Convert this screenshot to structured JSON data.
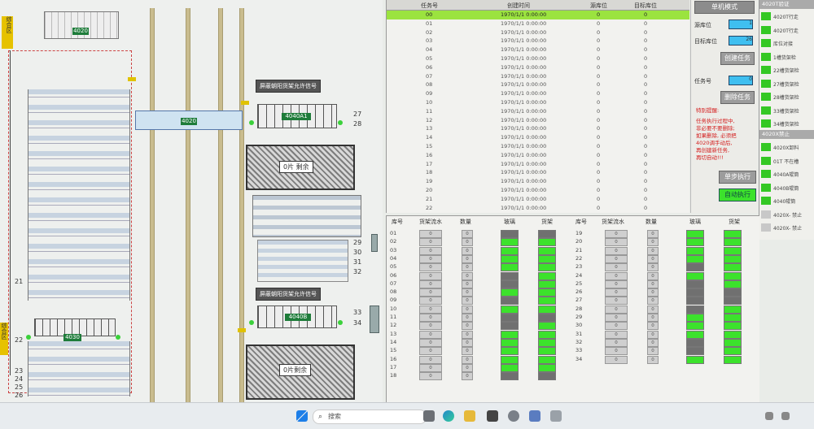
{
  "layout": {
    "station_labels": [
      "4020",
      "4020",
      "4030"
    ],
    "signal_labels": [
      "屏蔽朝阳货架允许信号",
      "屏蔽朝阳货架允许信号"
    ],
    "machine_labels": [
      "4040A1",
      "4040B"
    ],
    "remaining_labels": [
      "0片 剩余",
      "0片剩余"
    ],
    "row_numbers_left": [
      "21",
      "22",
      "23",
      "24",
      "25",
      "26"
    ],
    "row_numbers_mid": [
      "27",
      "28",
      "29",
      "30",
      "31",
      "32",
      "33",
      "34"
    ],
    "side_labels": [
      "综合区",
      "综合区"
    ]
  },
  "task_table": {
    "headers": [
      "任务号",
      "创建时间",
      "源库位",
      "目标库位"
    ],
    "rows": [
      {
        "id": "00",
        "time": "1970/1/1 0:00:00",
        "src": "0",
        "dst": "0"
      },
      {
        "id": "01",
        "time": "1970/1/1 0:00:00",
        "src": "0",
        "dst": "0"
      },
      {
        "id": "02",
        "time": "1970/1/1 0:00:00",
        "src": "0",
        "dst": "0"
      },
      {
        "id": "03",
        "time": "1970/1/1 0:00:00",
        "src": "0",
        "dst": "0"
      },
      {
        "id": "04",
        "time": "1970/1/1 0:00:00",
        "src": "0",
        "dst": "0"
      },
      {
        "id": "05",
        "time": "1970/1/1 0:00:00",
        "src": "0",
        "dst": "0"
      },
      {
        "id": "06",
        "time": "1970/1/1 0:00:00",
        "src": "0",
        "dst": "0"
      },
      {
        "id": "07",
        "time": "1970/1/1 0:00:00",
        "src": "0",
        "dst": "0"
      },
      {
        "id": "08",
        "time": "1970/1/1 0:00:00",
        "src": "0",
        "dst": "0"
      },
      {
        "id": "09",
        "time": "1970/1/1 0:00:00",
        "src": "0",
        "dst": "0"
      },
      {
        "id": "10",
        "time": "1970/1/1 0:00:00",
        "src": "0",
        "dst": "0"
      },
      {
        "id": "11",
        "time": "1970/1/1 0:00:00",
        "src": "0",
        "dst": "0"
      },
      {
        "id": "12",
        "time": "1970/1/1 0:00:00",
        "src": "0",
        "dst": "0"
      },
      {
        "id": "13",
        "time": "1970/1/1 0:00:00",
        "src": "0",
        "dst": "0"
      },
      {
        "id": "14",
        "time": "1970/1/1 0:00:00",
        "src": "0",
        "dst": "0"
      },
      {
        "id": "15",
        "time": "1970/1/1 0:00:00",
        "src": "0",
        "dst": "0"
      },
      {
        "id": "16",
        "time": "1970/1/1 0:00:00",
        "src": "0",
        "dst": "0"
      },
      {
        "id": "17",
        "time": "1970/1/1 0:00:00",
        "src": "0",
        "dst": "0"
      },
      {
        "id": "18",
        "time": "1970/1/1 0:00:00",
        "src": "0",
        "dst": "0"
      },
      {
        "id": "19",
        "time": "1970/1/1 0:00:00",
        "src": "0",
        "dst": "0"
      },
      {
        "id": "20",
        "time": "1970/1/1 0:00:00",
        "src": "0",
        "dst": "0"
      },
      {
        "id": "21",
        "time": "1970/1/1 0:00:00",
        "src": "0",
        "dst": "0"
      },
      {
        "id": "22",
        "time": "1970/1/1 0:00:00",
        "src": "0",
        "dst": "0"
      }
    ]
  },
  "mode_panel": {
    "title": "单机模式",
    "src_label": "源库位",
    "dst_label": "目标库位",
    "src_value": "1",
    "dst_value": "26",
    "create_button": "创建任务",
    "task_id_label": "任务号",
    "task_id_value": "0",
    "delete_button": "删除任务",
    "warning_lines": [
      "特别提醒:",
      "任务执行过程中,",
      "非必要不要删除;",
      "如果删除, 必须把",
      "4020调手动后,",
      "再创建新任务,",
      "再切自动!!!"
    ],
    "step_button": "单步执行",
    "auto_button": "自动执行"
  },
  "status_list": {
    "header1": "4020T验证",
    "items1": [
      {
        "text": "4020T行走",
        "on": true
      },
      {
        "text": "4020T行走",
        "on": true
      },
      {
        "text": "库位对接",
        "on": true
      },
      {
        "text": "1槽货架检",
        "on": true
      },
      {
        "text": "22槽货架检",
        "on": true
      },
      {
        "text": "27槽货架检",
        "on": true
      },
      {
        "text": "28槽货架检",
        "on": true
      },
      {
        "text": "33槽货架检",
        "on": true
      },
      {
        "text": "34槽货架检",
        "on": true
      }
    ],
    "header2": "4020X禁止",
    "items2": [
      {
        "text": "4020X卸料",
        "on": true
      },
      {
        "text": "01T 不在槽",
        "on": true
      },
      {
        "text": "4040A辊筒",
        "on": true
      },
      {
        "text": "4040B辊筒",
        "on": true
      },
      {
        "text": "4040辊筒",
        "on": true
      },
      {
        "text": "4020X- 禁止",
        "on": false
      },
      {
        "text": "4020X- 禁止",
        "on": false
      }
    ]
  },
  "location_table": {
    "headers": [
      "库号",
      "货架流水",
      "数量",
      "玻璃",
      "货架",
      "库号",
      "货架流水",
      "数量",
      "玻璃",
      "货架"
    ],
    "left": [
      {
        "no": "01",
        "serial": "0",
        "qty": "0",
        "glass": false,
        "rack": false
      },
      {
        "no": "02",
        "serial": "0",
        "qty": "0",
        "glass": true,
        "rack": true
      },
      {
        "no": "03",
        "serial": "0",
        "qty": "0",
        "glass": true,
        "rack": true
      },
      {
        "no": "04",
        "serial": "0",
        "qty": "0",
        "glass": true,
        "rack": true
      },
      {
        "no": "05",
        "serial": "0",
        "qty": "0",
        "glass": true,
        "rack": true
      },
      {
        "no": "06",
        "serial": "0",
        "qty": "0",
        "glass": false,
        "rack": true
      },
      {
        "no": "07",
        "serial": "0",
        "qty": "0",
        "glass": false,
        "rack": true
      },
      {
        "no": "08",
        "serial": "0",
        "qty": "0",
        "glass": true,
        "rack": true
      },
      {
        "no": "09",
        "serial": "0",
        "qty": "0",
        "glass": false,
        "rack": true
      },
      {
        "no": "10",
        "serial": "0",
        "qty": "0",
        "glass": true,
        "rack": true
      },
      {
        "no": "11",
        "serial": "0",
        "qty": "0",
        "glass": false,
        "rack": false
      },
      {
        "no": "12",
        "serial": "0",
        "qty": "0",
        "glass": false,
        "rack": true
      },
      {
        "no": "13",
        "serial": "0",
        "qty": "0",
        "glass": true,
        "rack": true
      },
      {
        "no": "14",
        "serial": "0",
        "qty": "0",
        "glass": true,
        "rack": true
      },
      {
        "no": "15",
        "serial": "0",
        "qty": "0",
        "glass": true,
        "rack": true
      },
      {
        "no": "16",
        "serial": "0",
        "qty": "0",
        "glass": true,
        "rack": true
      },
      {
        "no": "17",
        "serial": "0",
        "qty": "0",
        "glass": true,
        "rack": true
      },
      {
        "no": "18",
        "serial": "0",
        "qty": "0",
        "glass": false,
        "rack": false
      }
    ],
    "right": [
      {
        "no": "19",
        "serial": "0",
        "qty": "0",
        "glass": true,
        "rack": true
      },
      {
        "no": "20",
        "serial": "0",
        "qty": "0",
        "glass": true,
        "rack": true
      },
      {
        "no": "21",
        "serial": "0",
        "qty": "0",
        "glass": true,
        "rack": true
      },
      {
        "no": "22",
        "serial": "0",
        "qty": "0",
        "glass": true,
        "rack": true
      },
      {
        "no": "23",
        "serial": "0",
        "qty": "0",
        "glass": false,
        "rack": true
      },
      {
        "no": "24",
        "serial": "0",
        "qty": "0",
        "glass": true,
        "rack": true
      },
      {
        "no": "25",
        "serial": "0",
        "qty": "0",
        "glass": false,
        "rack": true
      },
      {
        "no": "26",
        "serial": "0",
        "qty": "0",
        "glass": false,
        "rack": false
      },
      {
        "no": "27",
        "serial": "0",
        "qty": "0",
        "glass": false,
        "rack": false
      },
      {
        "no": "28",
        "serial": "0",
        "qty": "0",
        "glass": false,
        "rack": true
      },
      {
        "no": "29",
        "serial": "0",
        "qty": "0",
        "glass": true,
        "rack": true
      },
      {
        "no": "30",
        "serial": "0",
        "qty": "0",
        "glass": true,
        "rack": true
      },
      {
        "no": "31",
        "serial": "0",
        "qty": "0",
        "glass": true,
        "rack": true
      },
      {
        "no": "32",
        "serial": "0",
        "qty": "0",
        "glass": false,
        "rack": true
      },
      {
        "no": "33",
        "serial": "0",
        "qty": "0",
        "glass": false,
        "rack": true
      },
      {
        "no": "34",
        "serial": "0",
        "qty": "0",
        "glass": true,
        "rack": true
      }
    ]
  },
  "taskbar": {
    "search_placeholder": "搜索"
  },
  "colors": {
    "green": "#3ce22c",
    "selected_row": "#9be33f",
    "cyan": "#3fbff0",
    "dark_cell": "#707070",
    "warning_red": "#d42020"
  }
}
